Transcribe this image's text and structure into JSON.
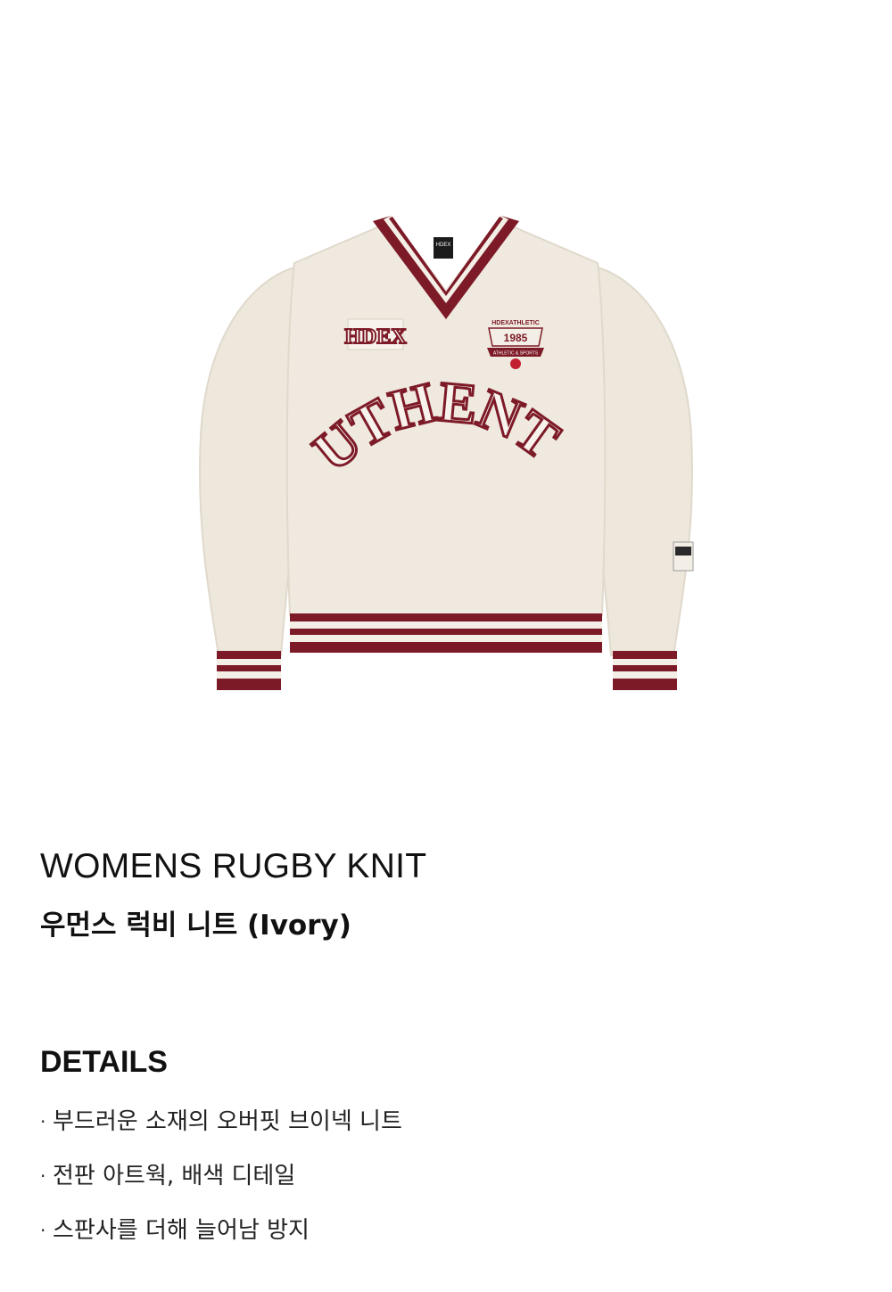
{
  "product": {
    "title_en": "WOMENS RUGBY KNIT",
    "title_ko": "우먼스 럭비 니트 (Ivory)",
    "image": {
      "alt_icon": "sweater-image",
      "chest_left_text": "HDEX",
      "chest_big_text": "AUTHENTIC",
      "emblem_top": "HDEXATHLETIC",
      "emblem_year": "1985",
      "emblem_bottom": "ATHLETIC & SPORTS",
      "neck_label": "HDEX",
      "colors": {
        "body": "#ede7dc",
        "stripe": "#7d1a27",
        "stripe_cream": "#f4efe6"
      }
    }
  },
  "details": {
    "heading": "DETAILS",
    "bullet": "·",
    "items": [
      "부드러운 소재의 오버핏 브이넥 니트",
      "전판 아트웍, 배색 디테일",
      "스판사를 더해 늘어남 방지"
    ]
  }
}
